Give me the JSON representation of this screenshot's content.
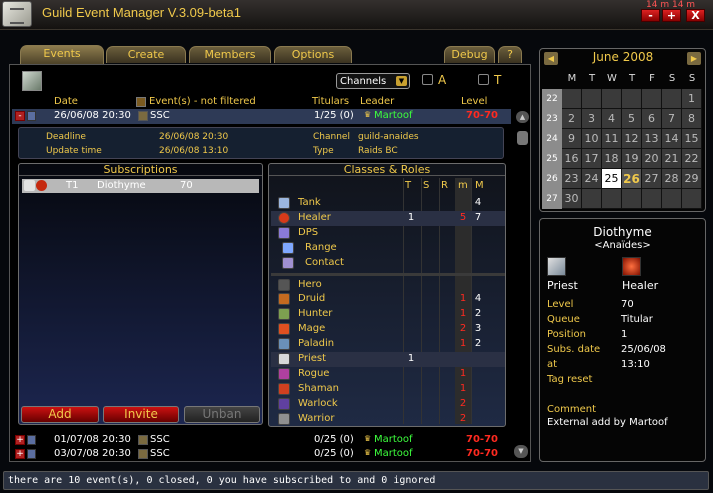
{
  "window": {
    "title": "Guild Event Manager V.3.09-beta1",
    "clock_top": "14 m",
    "clock_right": "14 m",
    "btn_min": "-",
    "btn_add": "+",
    "btn_close": "X"
  },
  "tabs": {
    "events": "Events",
    "create": "Create",
    "members": "Members",
    "options": "Options",
    "debug": "Debug",
    "help": "?"
  },
  "filters": {
    "channels_label": "Channels",
    "a_label": "A",
    "t_label": "T"
  },
  "event_list": {
    "headers": {
      "date": "Date",
      "events": "Event(s) - not filtered",
      "titulars": "Titulars",
      "leader": "Leader",
      "level": "Level"
    },
    "selected": {
      "expand": "-",
      "date": "26/06/08 20:30",
      "name": "SSC",
      "titulars": "1/25 (0)",
      "leader": "Martoof",
      "level": "70-70"
    },
    "details": {
      "deadline_label": "Deadline",
      "deadline": "26/06/08 20:30",
      "update_label": "Update time",
      "update": "26/06/08 13:10",
      "channel_label": "Channel",
      "channel": "guild-anaides",
      "type_label": "Type",
      "type": "Raids BC"
    },
    "rows": [
      {
        "expand": "+",
        "date": "01/07/08 20:30",
        "name": "SSC",
        "titulars": "0/25 (0)",
        "leader": "Martoof",
        "level": "70-70"
      },
      {
        "expand": "+",
        "date": "03/07/08 20:30",
        "name": "SSC",
        "titulars": "0/25 (0)",
        "leader": "Martoof",
        "level": "70-70"
      }
    ]
  },
  "subscriptions": {
    "title": "Subscriptions",
    "rows": [
      {
        "rank": "T1",
        "name": "Diothyme",
        "level": "70"
      }
    ],
    "add": "Add",
    "invite": "Invite",
    "unban": "Unban"
  },
  "classes": {
    "title": "Classes & Roles",
    "cols": {
      "t": "T",
      "s": "S",
      "r": "R",
      "m": "m",
      "M": "M"
    },
    "roles": [
      {
        "name": "Tank",
        "t": "",
        "m": "",
        "M": "4",
        "icon": "shield-icon",
        "color": "#9bb6df"
      },
      {
        "name": "Healer",
        "t": "1",
        "m": "5",
        "M": "7",
        "icon": "healer-icon",
        "color": "#d63a1a"
      },
      {
        "name": "DPS",
        "t": "",
        "m": "",
        "M": "",
        "icon": "sword-icon",
        "color": "#8a7ad8"
      },
      {
        "name": "Range",
        "t": "",
        "m": "",
        "M": "",
        "icon": "bolt-icon",
        "color": "#7fa8ff"
      },
      {
        "name": "Contact",
        "t": "",
        "m": "",
        "M": "",
        "icon": "fist-icon",
        "color": "#a090d0"
      }
    ],
    "hero": "Hero",
    "list": [
      {
        "name": "Druid",
        "t": "",
        "m": "1",
        "M": "4",
        "icon": "paw-icon",
        "color": "#c46a20"
      },
      {
        "name": "Hunter",
        "t": "",
        "m": "1",
        "M": "2",
        "icon": "bow-icon",
        "color": "#7da050"
      },
      {
        "name": "Mage",
        "t": "",
        "m": "2",
        "M": "3",
        "icon": "fire-icon",
        "color": "#e05020"
      },
      {
        "name": "Paladin",
        "t": "",
        "m": "1",
        "M": "2",
        "icon": "hammer-icon",
        "color": "#6a90b8"
      },
      {
        "name": "Priest",
        "t": "1",
        "m": "",
        "M": "",
        "icon": "cross-icon",
        "color": "#d8d8d8"
      },
      {
        "name": "Rogue",
        "t": "",
        "m": "1",
        "M": "",
        "icon": "dagger-icon",
        "color": "#b040a0"
      },
      {
        "name": "Shaman",
        "t": "",
        "m": "1",
        "M": "",
        "icon": "totem-icon",
        "color": "#d04020"
      },
      {
        "name": "Warlock",
        "t": "",
        "m": "2",
        "M": "",
        "icon": "skull-icon",
        "color": "#6040a0"
      },
      {
        "name": "Warrior",
        "t": "",
        "m": "2",
        "M": "",
        "icon": "axe-icon",
        "color": "#909090"
      }
    ]
  },
  "calendar": {
    "title": "June 2008",
    "prev": "◀",
    "next": "▶",
    "days": [
      "M",
      "T",
      "W",
      "T",
      "F",
      "S",
      "S"
    ],
    "weeks": [
      {
        "wk": "22",
        "days": [
          "",
          "",
          "",
          "",
          "",
          "",
          "1"
        ]
      },
      {
        "wk": "23",
        "days": [
          "2",
          "3",
          "4",
          "5",
          "6",
          "7",
          "8"
        ]
      },
      {
        "wk": "24",
        "days": [
          "9",
          "10",
          "11",
          "12",
          "13",
          "14",
          "15"
        ]
      },
      {
        "wk": "25",
        "days": [
          "16",
          "17",
          "18",
          "19",
          "20",
          "21",
          "22"
        ]
      },
      {
        "wk": "26",
        "days": [
          "23",
          "24",
          "25",
          "26",
          "27",
          "28",
          "29"
        ]
      },
      {
        "wk": "27",
        "days": [
          "30",
          "",
          "",
          "",
          "",
          "",
          ""
        ]
      }
    ]
  },
  "detail": {
    "name": "Diothyme",
    "guild": "<Anaïdes>",
    "class": "Priest",
    "role": "Healer",
    "level_label": "Level",
    "level": "70",
    "queue_label": "Queue",
    "queue": "Titular",
    "position_label": "Position",
    "position": "1",
    "subs_label": "Subs. date",
    "subs": "25/06/08",
    "at_label": "at",
    "at": "13:10",
    "tag_label": "Tag reset",
    "comment_label": "Comment",
    "comment": "External add by Martoof"
  },
  "status": "there are 10 event(s), 0 closed, 0 you have subscribed to and 0 ignored"
}
